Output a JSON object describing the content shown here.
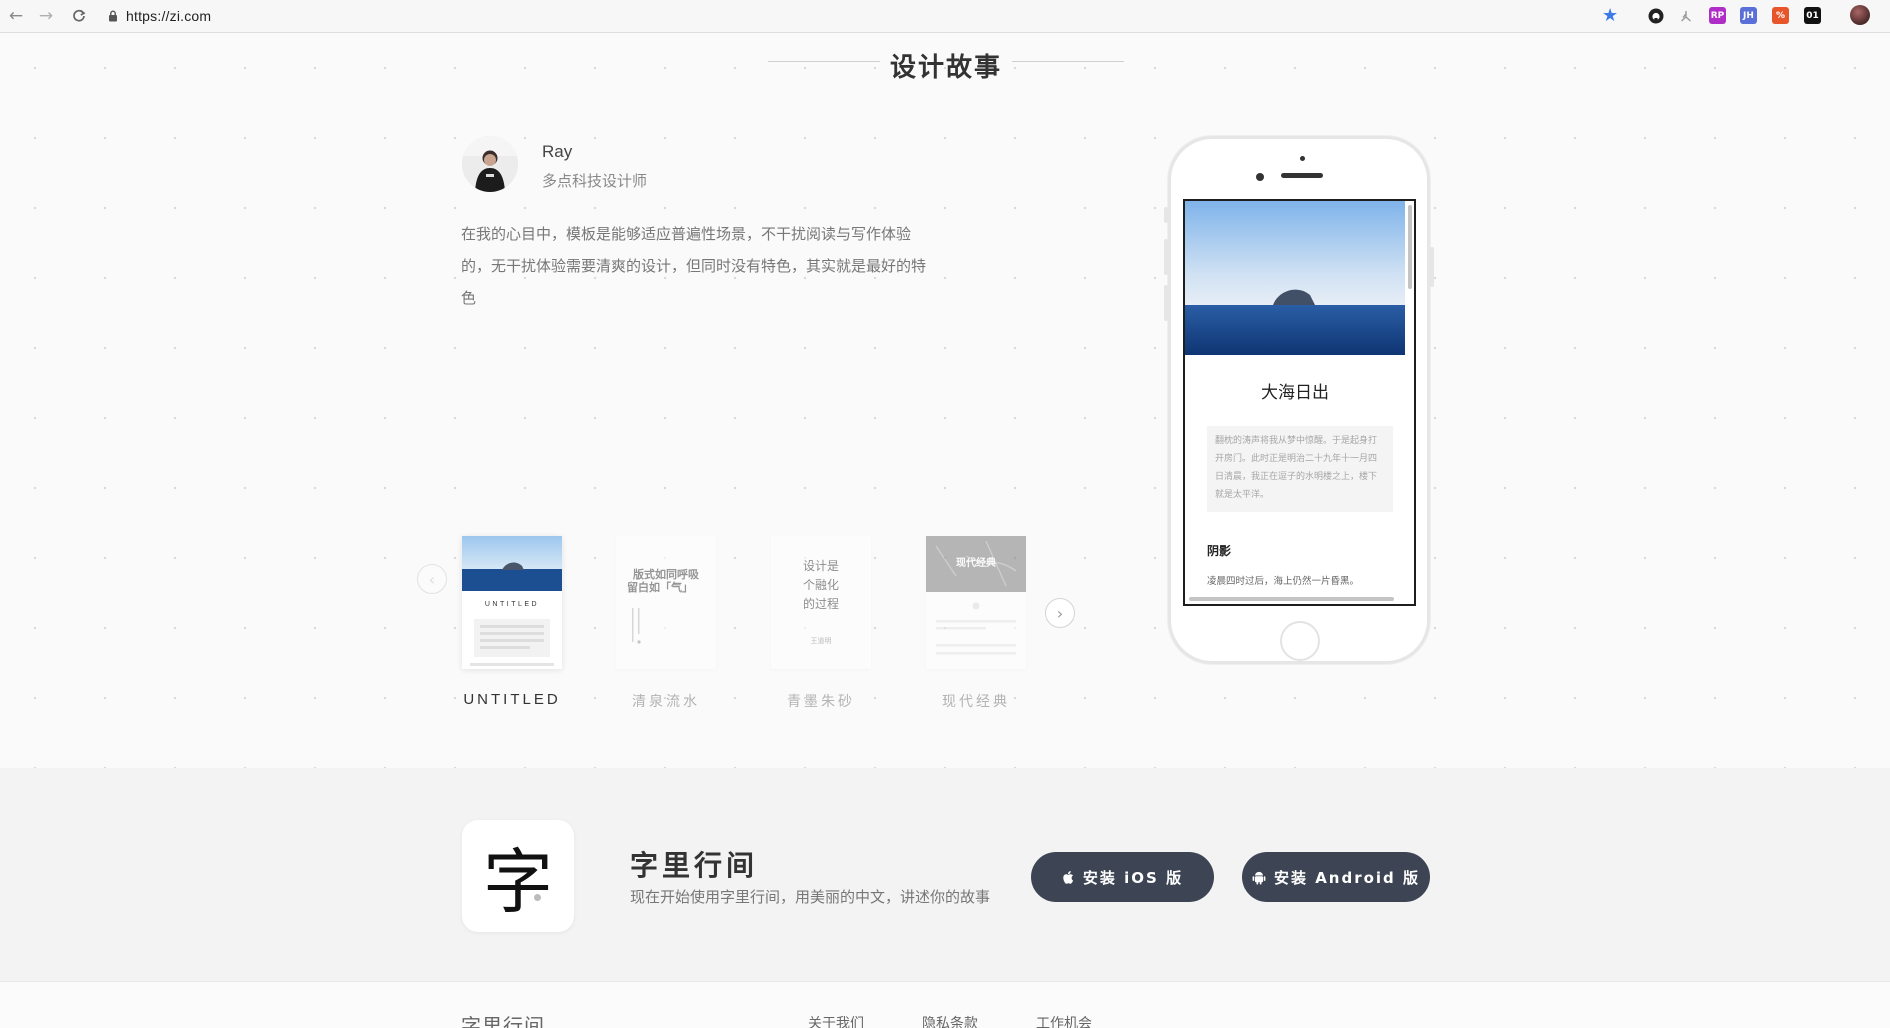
{
  "browser": {
    "url": "https://zi.com",
    "extensions": [
      "github-icon",
      "tree-icon",
      "rp-extension-icon",
      "jh-extension-icon",
      "percent-extension-icon",
      "o1-extension-icon"
    ],
    "extension_labels": [
      "RP",
      "JH",
      "%",
      "01"
    ]
  },
  "story": {
    "section_title": "设计故事",
    "author_name": "Ray",
    "author_title": "多点科技设计师",
    "quote": "在我的心目中，模板是能够适应普遍性场景，不干扰阅读与写作体验的，无干扰体验需要清爽的设计，但同时没有特色，其实就是最好的特色"
  },
  "templates": [
    {
      "name": "UNTITLED",
      "active": true,
      "card_text": "UNTITLED"
    },
    {
      "name": "清泉流水",
      "active": false,
      "card_text": "版式如同呼吸 留白如「气」"
    },
    {
      "name": "青墨朱砂",
      "active": false,
      "card_text": "设计是 个融化 的过程",
      "card_author": "王道明"
    },
    {
      "name": "现代经典",
      "active": false,
      "card_text": "现代经典"
    }
  ],
  "phone_preview": {
    "article_title": "大海日出",
    "abstract": "翻枕的涛声将我从梦中惊醒。于是起身打开房门。此时正是明治二十九年十一月四日清晨，我正在逗子的水明楼之上，楼下就是太平洋。",
    "section_heading": "阴影",
    "body": "凌晨四时过后，海上仍然一片昏黑。"
  },
  "banner": {
    "app_icon_char": "字",
    "app_name": "字里行间",
    "app_desc": "现在开始使用字里行间，用美丽的中文，讲述你的故事",
    "ios_button": "安装 iOS 版",
    "android_button": "安装 Android 版"
  },
  "footer": {
    "logo": "字里行间",
    "links": [
      "关于我们",
      "隐私条款",
      "工作机会"
    ]
  },
  "colors": {
    "button_bg": "#3d4554",
    "chrome_star": "#3b7ae8",
    "ext_rp": "#b02ec7",
    "ext_jh": "#5a6fd8",
    "ext_percent": "#e8552b",
    "ext_o1": "#111111"
  }
}
